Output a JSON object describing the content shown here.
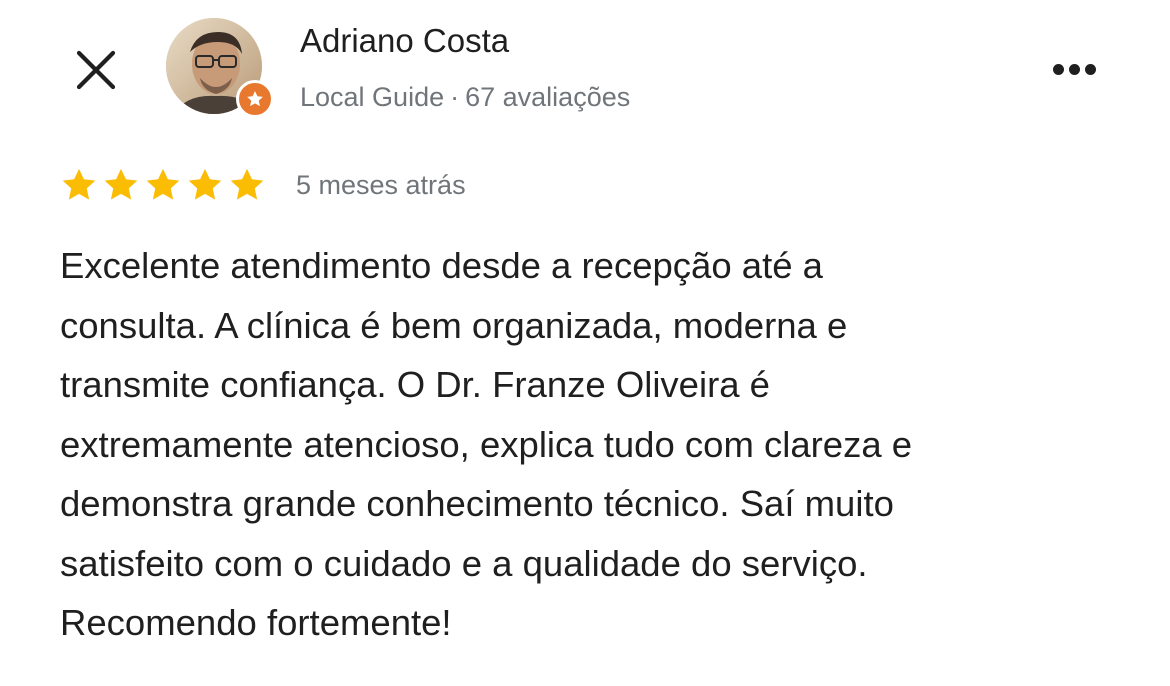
{
  "header": {
    "close_icon": "close-icon",
    "user": {
      "name": "Adriano Costa",
      "level": "Local Guide",
      "separator": "·",
      "reviews_count": "67 avaliações",
      "badge_icon": "local-guide-star-icon",
      "badge_color": "#e8782e"
    },
    "menu_icon": "more-horizontal-icon"
  },
  "review": {
    "rating": 5,
    "max_rating": 5,
    "star_color": "#fbbc04",
    "time_ago": "5 meses atrás",
    "lines": [
      "Excelente atendimento desde a recepção até a",
      "consulta. A clínica é bem organizada, moderna e",
      "transmite confiança. O Dr. Franze Oliveira é",
      "extremamente atencioso, explica tudo com clareza e",
      "demonstra grande conhecimento técnico. Saí muito",
      "satisfeito com o cuidado e a qualidade do serviço.",
      "Recomendo fortemente!"
    ]
  },
  "colors": {
    "text_primary": "#1f1f1f",
    "text_secondary": "#70757a",
    "background": "#ffffff"
  }
}
